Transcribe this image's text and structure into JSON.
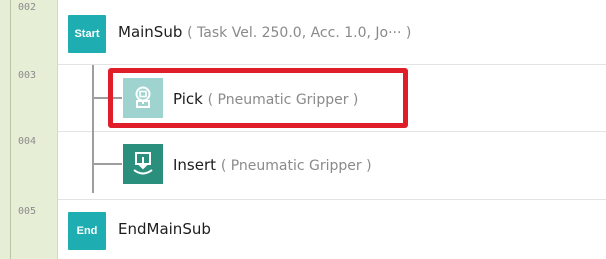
{
  "rows": [
    {
      "num": "002"
    },
    {
      "num": "003"
    },
    {
      "num": "004"
    },
    {
      "num": "005"
    }
  ],
  "start_block": {
    "badge": "Start",
    "name": "MainSub",
    "params": "( Task Vel. 250.0, Acc. 1.0, Jo··· )"
  },
  "pick_node": {
    "icon": "gripper-pick-icon",
    "name": "Pick",
    "params": "( Pneumatic Gripper )"
  },
  "insert_node": {
    "icon": "gripper-insert-icon",
    "name": "Insert",
    "params": "( Pneumatic Gripper )"
  },
  "end_block": {
    "badge": "End",
    "name": "EndMainSub"
  },
  "colors": {
    "gutter": "#e6efd6",
    "badge": "#1eaeb2",
    "pick_icon_bg": "#9ed3cf",
    "insert_icon_bg": "#2b8f7d",
    "highlight": "#e01e2a"
  }
}
